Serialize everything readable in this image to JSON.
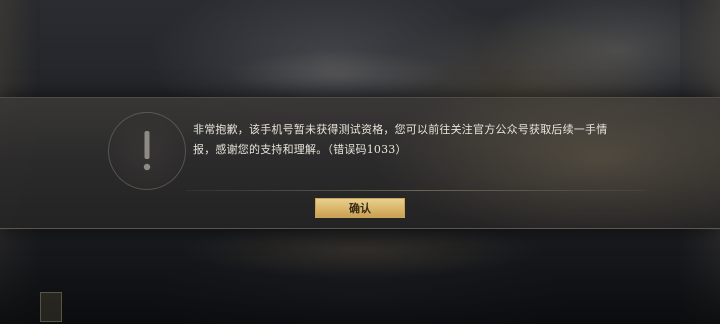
{
  "dialog": {
    "icon": "exclamation-icon",
    "message": "非常抱歉，该手机号暂未获得测试资格，您可以前往关注官方公众号获取后续一手情报，感谢您的支持和理解。（错误码1033）",
    "confirm_label": "确认"
  },
  "colors": {
    "button_fill": "#d9b66a",
    "button_text": "#3a2c15",
    "message_text": "#e8e4da"
  }
}
